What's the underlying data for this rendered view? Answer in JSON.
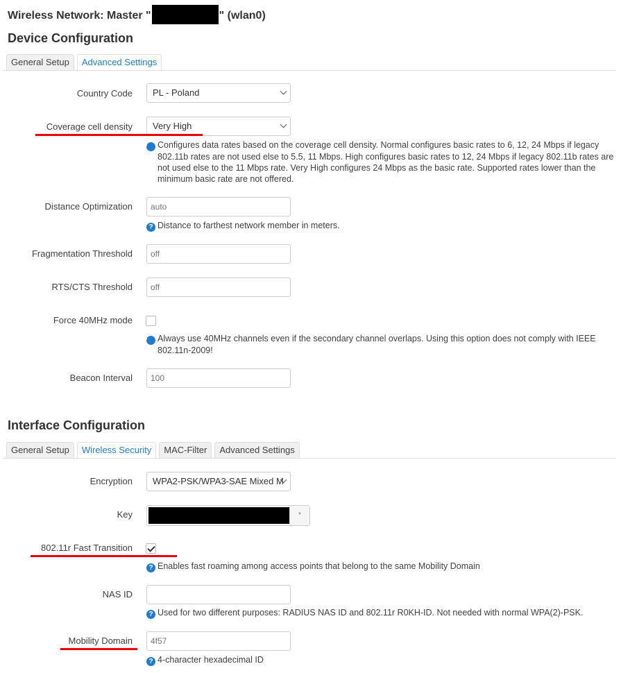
{
  "page": {
    "title_prefix": "Wireless Network: Master \"",
    "title_suffix": "\" (wlan0)"
  },
  "device_config": {
    "heading": "Device Configuration",
    "tabs": [
      {
        "label": "General Setup",
        "active": false
      },
      {
        "label": "Advanced Settings",
        "active": true
      }
    ],
    "fields": {
      "country_code": {
        "label": "Country Code",
        "value": "PL - Poland"
      },
      "coverage_cell_density": {
        "label": "Coverage cell density",
        "value": "Very High",
        "help": "Configures data rates based on the coverage cell density. Normal configures basic rates to 6, 12, 24 Mbps if legacy 802.11b rates are not used else to 5.5, 11 Mbps. High configures basic rates to 12, 24 Mbps if legacy 802.11b rates are not used else to the 11 Mbps rate. Very High configures 24 Mbps as the basic rate. Supported rates lower than the minimum basic rate are not offered."
      },
      "distance_optimization": {
        "label": "Distance Optimization",
        "placeholder": "auto",
        "help": "Distance to farthest network member in meters."
      },
      "fragmentation_threshold": {
        "label": "Fragmentation Threshold",
        "placeholder": "off"
      },
      "rts_cts_threshold": {
        "label": "RTS/CTS Threshold",
        "placeholder": "off"
      },
      "force_40mhz": {
        "label": "Force 40MHz mode",
        "checked": false,
        "help": "Always use 40MHz channels even if the secondary channel overlaps. Using this option does not comply with IEEE 802.11n-2009!"
      },
      "beacon_interval": {
        "label": "Beacon Interval",
        "placeholder": "100"
      }
    }
  },
  "interface_config": {
    "heading": "Interface Configuration",
    "tabs": [
      {
        "label": "General Setup",
        "active": false
      },
      {
        "label": "Wireless Security",
        "active": true
      },
      {
        "label": "MAC-Filter",
        "active": false
      },
      {
        "label": "Advanced Settings",
        "active": false
      }
    ],
    "fields": {
      "encryption": {
        "label": "Encryption",
        "value": "WPA2-PSK/WPA3-SAE Mixed M"
      },
      "key": {
        "label": "Key",
        "reveal_icon": "*"
      },
      "fast_transition": {
        "label": "802.11r Fast Transition",
        "checked": true,
        "help": "Enables fast roaming among access points that belong to the same Mobility Domain"
      },
      "nas_id": {
        "label": "NAS ID",
        "value": "",
        "help": "Used for two different purposes: RADIUS NAS ID and 802.11r R0KH-ID. Not needed with normal WPA(2)-PSK."
      },
      "mobility_domain": {
        "label": "Mobility Domain",
        "placeholder": "4f57",
        "help": "4-character hexadecimal ID"
      }
    }
  },
  "help_icon": "?",
  "colors": {
    "accent": "#1f7ccf",
    "highlight": "#e00000"
  }
}
